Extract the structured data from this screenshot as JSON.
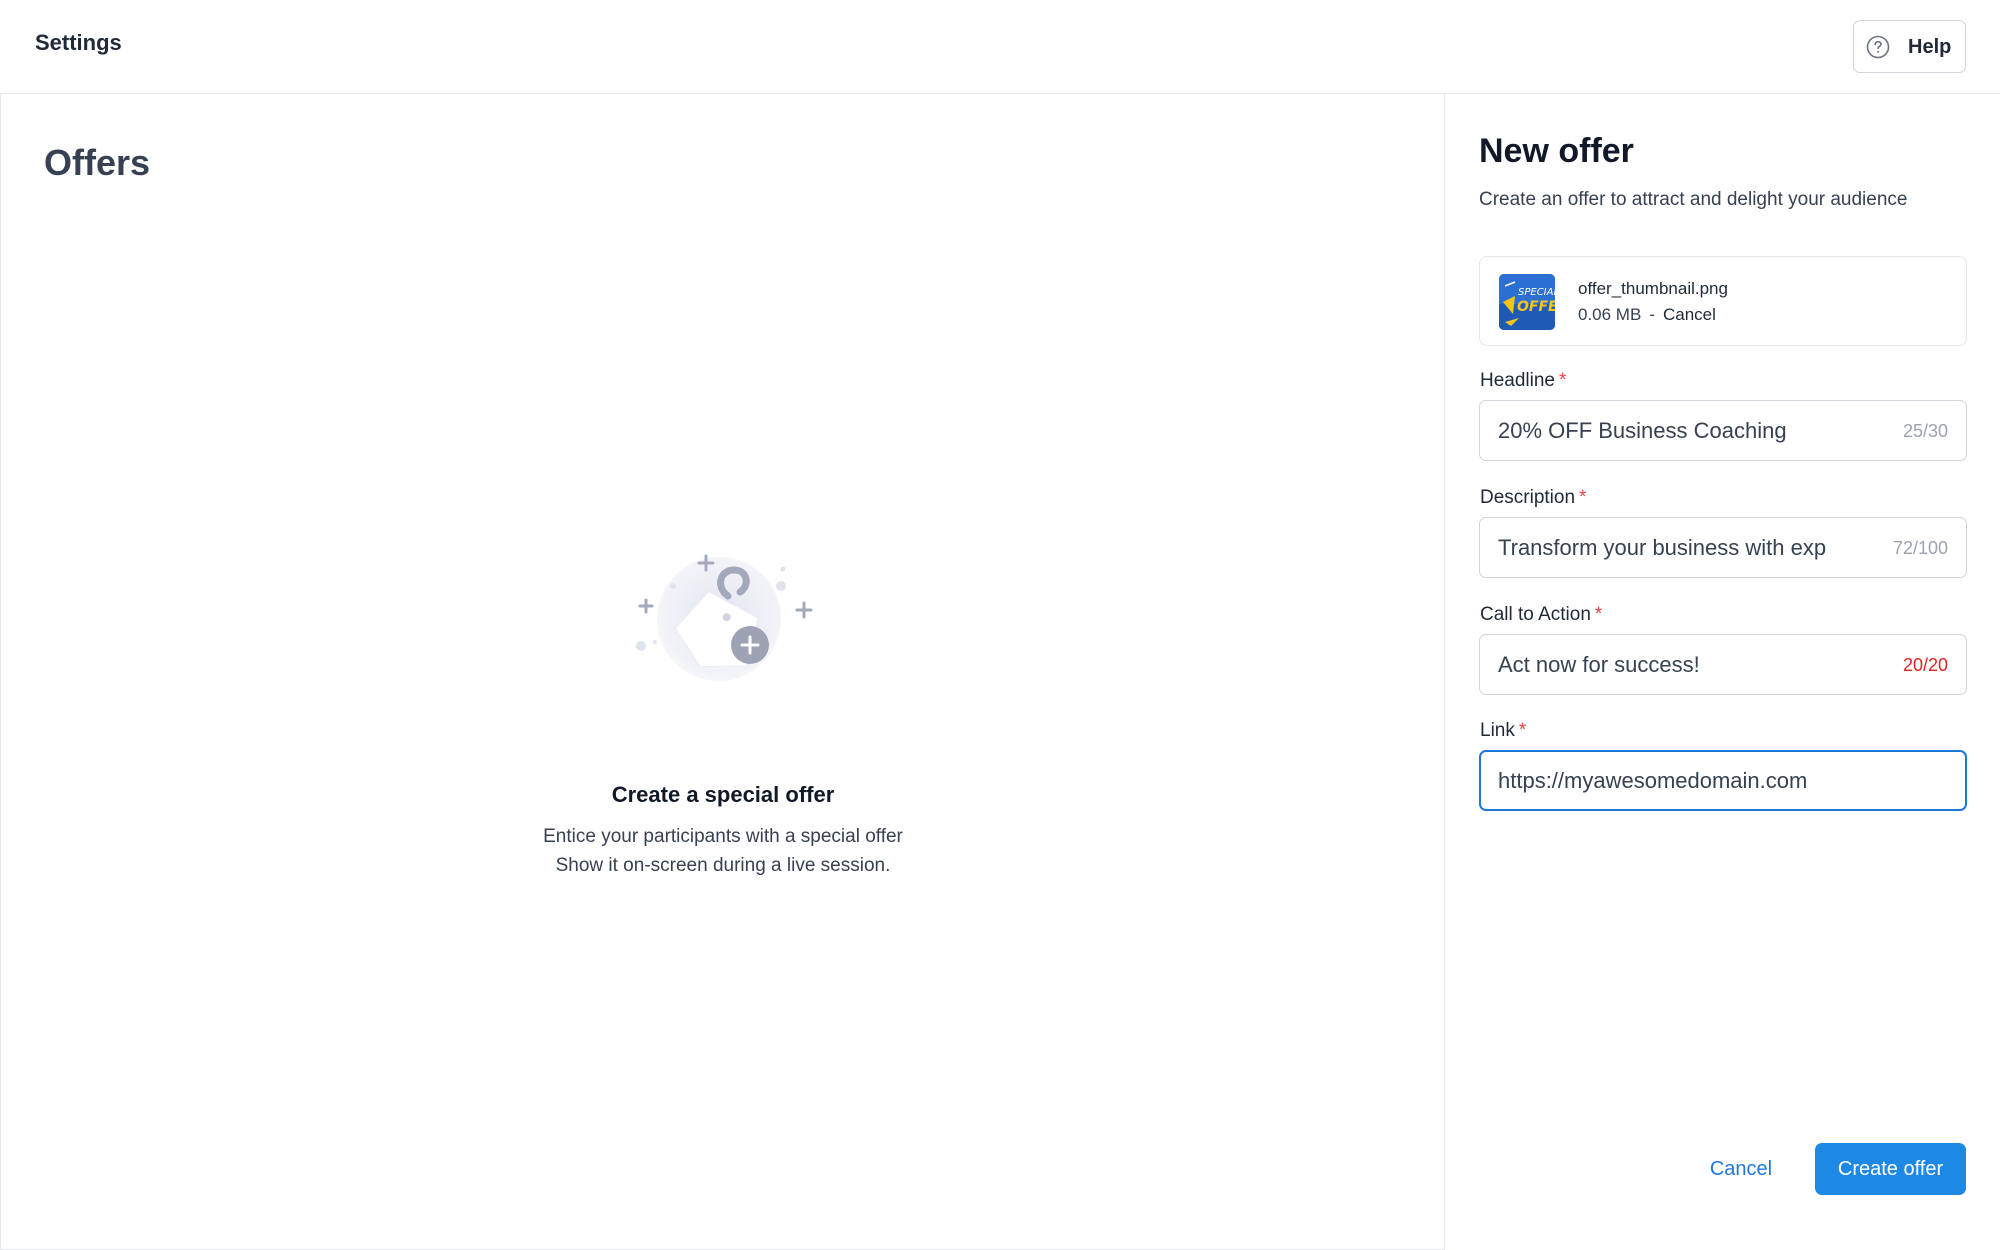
{
  "topbar": {
    "title": "Settings",
    "help_label": "Help"
  },
  "main": {
    "title": "Offers",
    "empty_state": {
      "heading": "Create a special offer",
      "line1": "Entice your participants with a special offer",
      "line2": "Show it on-screen during a live session."
    }
  },
  "panel": {
    "title": "New offer",
    "subtitle": "Create an offer to attract and delight your audience",
    "file": {
      "name": "offer_thumbnail.png",
      "size": "0.06 MB",
      "separator": "-",
      "cancel_label": "Cancel",
      "thumb_text_1": "SPECIAL",
      "thumb_text_2": "OFFER"
    },
    "fields": {
      "headline": {
        "label": "Headline",
        "required": "*",
        "value": "20% OFF Business Coaching",
        "counter": "25/30"
      },
      "description": {
        "label": "Description",
        "required": "*",
        "value": "Transform your business with exp",
        "counter": "72/100"
      },
      "cta": {
        "label": "Call to Action",
        "required": "*",
        "value": "Act now for success!",
        "counter": "20/20"
      },
      "link": {
        "label": "Link",
        "required": "*",
        "value": "https://myawesomedomain.com"
      }
    },
    "actions": {
      "cancel_label": "Cancel",
      "create_label": "Create offer"
    }
  },
  "colors": {
    "accent": "#1e88e5",
    "required": "#ef4444",
    "limit": "#dc2626"
  }
}
